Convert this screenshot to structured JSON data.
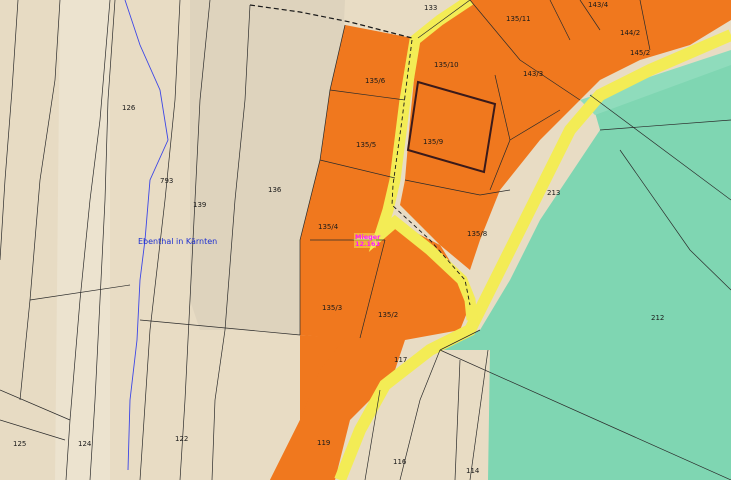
{
  "map": {
    "place_name": "Ebenthal in Kärnten",
    "marker": {
      "label": "Mieger",
      "sublabel": "12.163"
    },
    "parcels": [
      "133",
      "135/11",
      "143/4",
      "144/2",
      "145/2",
      "135/6",
      "135/10",
      "143/3",
      "126",
      "135/5",
      "135/9",
      "793",
      "139",
      "136",
      "213",
      "135/4",
      "135/8",
      "135/3",
      "135/2",
      "212",
      "117",
      "125",
      "124",
      "122",
      "119",
      "116",
      "114"
    ]
  },
  "colors": {
    "background": "#e8dcc4",
    "building_zone": "#f0781e",
    "road": "#f3ec55",
    "forest": "#7fd6b2",
    "boundary": "#2b2b2b",
    "parish_border": "#3c46e6",
    "highlight_outline": "#3a1a1a"
  }
}
